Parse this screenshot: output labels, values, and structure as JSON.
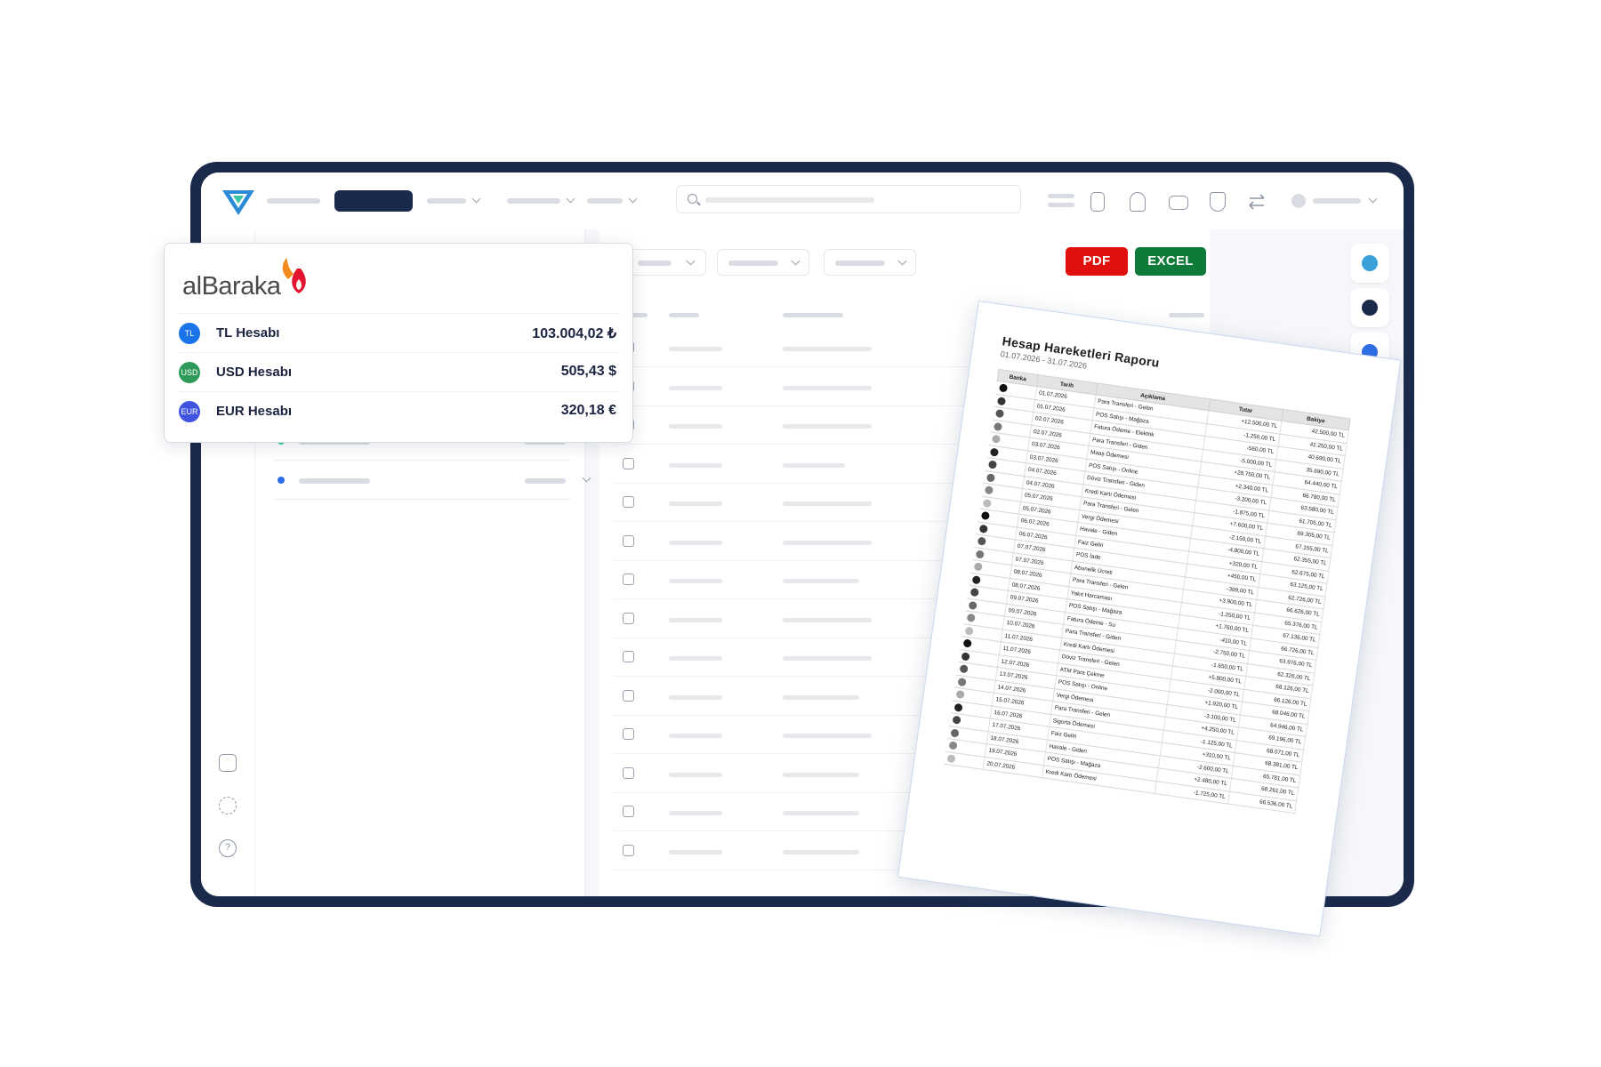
{
  "report_buttons": {
    "pdf": "PDF",
    "excel": "EXCEL"
  },
  "bank_card": {
    "brand": "alBaraka",
    "accounts": [
      {
        "badge": "TL",
        "name": "TL Hesabı",
        "amount": "103.004,02 ₺",
        "color": "#1a73e8"
      },
      {
        "badge": "USD",
        "name": "USD Hesabı",
        "amount": "505,43 $",
        "color": "#2e9b5a"
      },
      {
        "badge": "EUR",
        "name": "EUR Hesabı",
        "amount": "320,18 €",
        "color": "#4154e0"
      }
    ]
  },
  "left_panel_dots": [
    "#3ecfa8",
    "#2f6fe8"
  ],
  "right_rail_dots": [
    "#3aa0d8",
    "#1b2a4a",
    "#2f6fe8"
  ],
  "report": {
    "title": "Hesap Hareketleri Raporu",
    "period": "01.07.2026 - 31.07.2026",
    "columns": [
      "Banka",
      "Tarih",
      "Açıklama",
      "Tutar",
      "Bakiye"
    ],
    "rows": [
      [
        "01.07.2026",
        "Para Transferi - Gelen",
        "+12.500,00 TL",
        "42.500,00 TL"
      ],
      [
        "01.07.2026",
        "POS Satışı - Mağaza",
        "-1.250,00 TL",
        "41.250,00 TL"
      ],
      [
        "02.07.2026",
        "Fatura Ödeme - Elektrik",
        "-560,00 TL",
        "40.690,00 TL"
      ],
      [
        "02.07.2026",
        "Para Transferi - Giden",
        "-5.000,00 TL",
        "35.690,00 TL"
      ],
      [
        "03.07.2026",
        "Maaş Ödemesi",
        "+28.750,00 TL",
        "64.440,00 TL"
      ],
      [
        "03.07.2026",
        "POS Satışı - Online",
        "+2.340,00 TL",
        "66.780,00 TL"
      ],
      [
        "04.07.2026",
        "Döviz Transferi - Giden",
        "-3.200,00 TL",
        "63.580,00 TL"
      ],
      [
        "04.07.2026",
        "Kredi Kartı Ödemesi",
        "-1.875,00 TL",
        "61.705,00 TL"
      ],
      [
        "05.07.2026",
        "Para Transferi - Gelen",
        "+7.600,00 TL",
        "69.305,00 TL"
      ],
      [
        "05.07.2026",
        "Vergi Ödemesi",
        "-2.150,00 TL",
        "67.155,00 TL"
      ],
      [
        "06.07.2026",
        "Havale - Giden",
        "-4.800,00 TL",
        "62.355,00 TL"
      ],
      [
        "06.07.2026",
        "Faiz Geliri",
        "+320,00 TL",
        "62.675,00 TL"
      ],
      [
        "07.07.2026",
        "POS İade",
        "+450,00 TL",
        "63.125,00 TL"
      ],
      [
        "07.07.2026",
        "Abonelik Ücreti",
        "-399,00 TL",
        "62.726,00 TL"
      ],
      [
        "08.07.2026",
        "Para Transferi - Gelen",
        "+3.900,00 TL",
        "66.626,00 TL"
      ],
      [
        "08.07.2026",
        "Yakıt Harcaması",
        "-1.250,00 TL",
        "65.376,00 TL"
      ],
      [
        "09.07.2026",
        "POS Satışı - Mağaza",
        "+1.760,00 TL",
        "67.136,00 TL"
      ],
      [
        "09.07.2026",
        "Fatura Ödeme - Su",
        "-410,00 TL",
        "66.726,00 TL"
      ],
      [
        "10.07.2026",
        "Para Transferi - Giden",
        "-2.750,00 TL",
        "63.976,00 TL"
      ],
      [
        "11.07.2026",
        "Kredi Kartı Ödemesi",
        "-1.650,00 TL",
        "62.326,00 TL"
      ],
      [
        "11.07.2026",
        "Döviz Transferi - Gelen",
        "+5.800,00 TL",
        "68.126,00 TL"
      ],
      [
        "12.07.2026",
        "ATM Para Çekme",
        "-2.000,00 TL",
        "66.126,00 TL"
      ],
      [
        "13.07.2026",
        "POS Satışı - Online",
        "+1.920,00 TL",
        "68.046,00 TL"
      ],
      [
        "14.07.2026",
        "Vergi Ödemesi",
        "-3.100,00 TL",
        "64.946,00 TL"
      ],
      [
        "15.07.2026",
        "Para Transferi - Gelen",
        "+4.250,00 TL",
        "69.196,00 TL"
      ],
      [
        "16.07.2026",
        "Sigorta Ödemesi",
        "-1.125,00 TL",
        "68.071,00 TL"
      ],
      [
        "17.07.2026",
        "Faiz Geliri",
        "+310,00 TL",
        "68.381,00 TL"
      ],
      [
        "18.07.2026",
        "Havale - Giden",
        "-2.600,00 TL",
        "65.781,00 TL"
      ],
      [
        "19.07.2026",
        "POS Satışı - Mağaza",
        "+2.480,00 TL",
        "68.261,00 TL"
      ],
      [
        "20.07.2026",
        "Kredi Kartı Ödemesi",
        "-1.725,00 TL",
        "66.536,00 TL"
      ]
    ]
  }
}
